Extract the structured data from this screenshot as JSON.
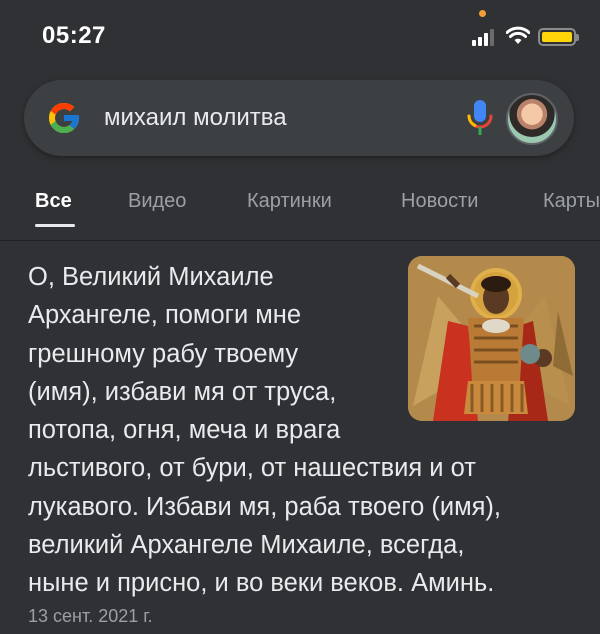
{
  "status_bar": {
    "time": "05:27",
    "battery_color": "#ffd60a",
    "signal_icon": "cellular-signal-icon",
    "wifi_icon": "wifi-icon",
    "battery_icon": "battery-icon"
  },
  "search": {
    "query": "михаил молитва",
    "logo_icon": "google-g-logo",
    "mic_icon": "microphone-icon",
    "avatar_icon": "user-avatar"
  },
  "tabs": [
    {
      "label": "Все",
      "active": true
    },
    {
      "label": "Видео",
      "active": false
    },
    {
      "label": "Картинки",
      "active": false
    },
    {
      "label": "Новости",
      "active": false
    },
    {
      "label": "Карты",
      "active": false
    }
  ],
  "result": {
    "lines": [
      "О, Великий Михаиле",
      "Архангеле, помоги мне",
      "грешному рабу твоему",
      "(имя), избави мя от труса,",
      "потопа, огня, меча и врага",
      "льстивого, от бури, от нашествия и от",
      "лукавого. Избави мя, раба твоего (имя),",
      "великий Архангеле Михаиле, всегда,",
      "ныне и присно, и во веки веков. Аминь."
    ],
    "date": "13 сент. 2021 г.",
    "image_icon": "archangel-michael-icon-image"
  },
  "colors": {
    "background": "#303134",
    "search_box": "#3c4043",
    "text_primary": "#e8eaed",
    "text_secondary": "#9aa0a6"
  }
}
